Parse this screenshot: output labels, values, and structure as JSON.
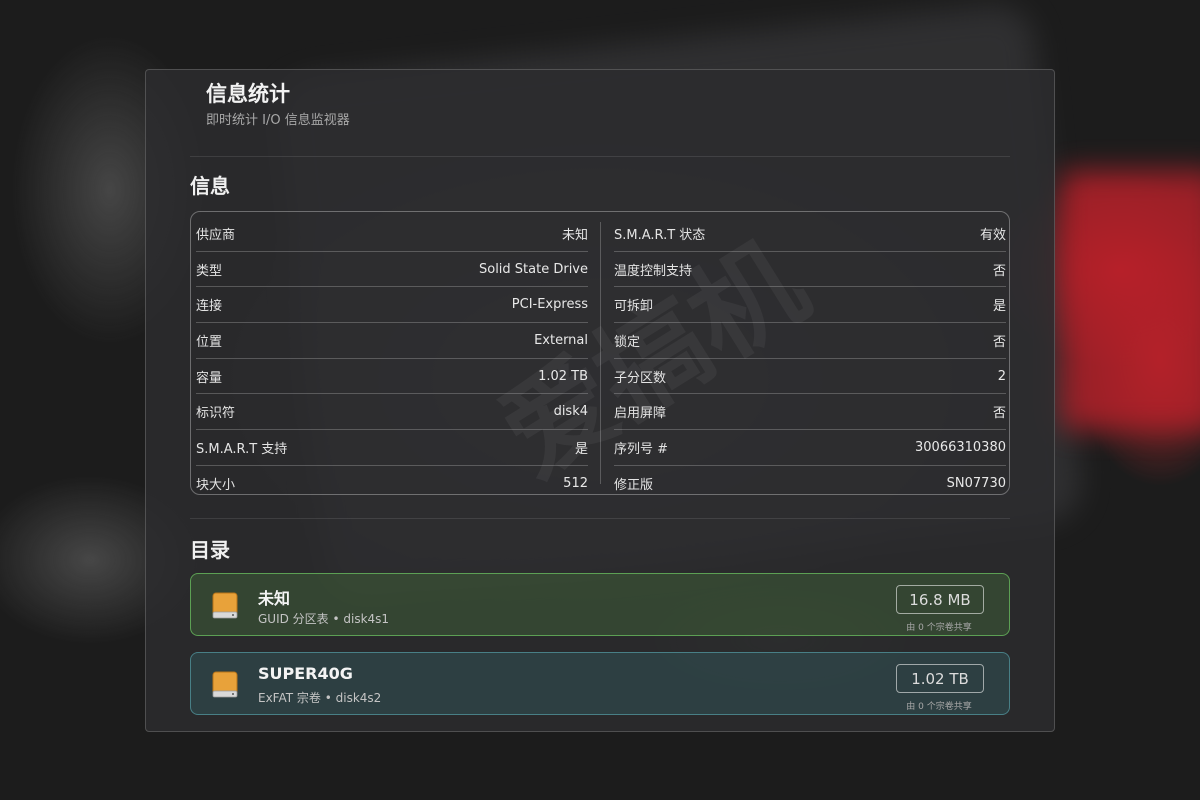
{
  "app": {
    "title": "信息统计",
    "subtitle": "即时统计 I/O 信息监视器"
  },
  "info": {
    "section_title": "信息",
    "left": [
      {
        "label": "供应商",
        "value": "未知"
      },
      {
        "label": "类型",
        "value": "Solid State Drive"
      },
      {
        "label": "连接",
        "value": "PCI-Express"
      },
      {
        "label": "位置",
        "value": "External"
      },
      {
        "label": "容量",
        "value": "1.02 TB"
      },
      {
        "label": "标识符",
        "value": "disk4"
      },
      {
        "label": "S.M.A.R.T 支持",
        "value": "是"
      },
      {
        "label": "块大小",
        "value": "512"
      }
    ],
    "right": [
      {
        "label": "S.M.A.R.T 状态",
        "value": "有效"
      },
      {
        "label": "温度控制支持",
        "value": "否"
      },
      {
        "label": "可拆卸",
        "value": "是"
      },
      {
        "label": "锁定",
        "value": "否"
      },
      {
        "label": "子分区数",
        "value": "2"
      },
      {
        "label": "启用屏障",
        "value": "否"
      },
      {
        "label": "序列号 #",
        "value": "30066310380"
      },
      {
        "label": "修正版",
        "value": "SN07730"
      }
    ]
  },
  "directory": {
    "section_title": "目录",
    "volumes": [
      {
        "name": "未知",
        "desc": "GUID 分区表 • disk4s1",
        "size": "16.8 MB",
        "shared": "由 0 个宗卷共享",
        "icon": "drive-icon"
      },
      {
        "name": "SUPER40G",
        "desc": "ExFAT 宗卷 • disk4s2",
        "size": "1.02 TB",
        "shared": "由 0 个宗卷共享",
        "icon": "drive-icon"
      }
    ]
  },
  "watermark": "爱搞机",
  "colors": {
    "panel_bg": "#2c2c2e",
    "green_card": "#6ec864",
    "teal_card": "#5aaab4",
    "disk_icon": "#e8a23a"
  }
}
